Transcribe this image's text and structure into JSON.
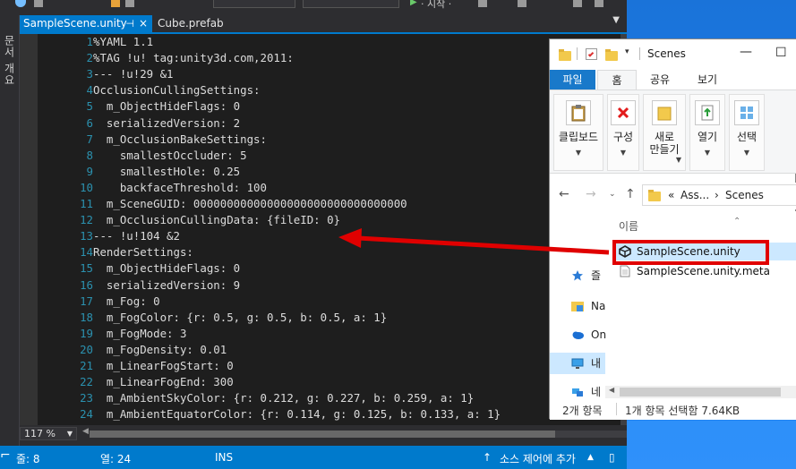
{
  "vs": {
    "toolbar": {
      "run_label_partial": "· 시작 ·"
    },
    "sidetool_label": "문서 개요",
    "tabs": [
      {
        "label": "SampleScene.unity",
        "pin": "⊣",
        "close": "×"
      },
      {
        "label": "Cube.prefab"
      }
    ],
    "code_lines": [
      {
        "n": "1",
        "text": "%YAML 1.1"
      },
      {
        "n": "2",
        "text": "%TAG !u! tag:unity3d.com,2011:"
      },
      {
        "n": "3",
        "text": "--- !u!29 &1"
      },
      {
        "n": "4",
        "text": "OcclusionCullingSettings:"
      },
      {
        "n": "5",
        "text": "  m_ObjectHideFlags: 0"
      },
      {
        "n": "6",
        "text": "  serializedVersion: 2"
      },
      {
        "n": "7",
        "text": "  m_OcclusionBakeSettings:"
      },
      {
        "n": "8",
        "text": "    smallestOccluder: 5"
      },
      {
        "n": "9",
        "text": "    smallestHole: 0.25"
      },
      {
        "n": "10",
        "text": "    backfaceThreshold: 100"
      },
      {
        "n": "11",
        "text": "  m_SceneGUID: 00000000000000000000000000000000"
      },
      {
        "n": "12",
        "text": "  m_OcclusionCullingData: {fileID: 0}"
      },
      {
        "n": "13",
        "text": "--- !u!104 &2"
      },
      {
        "n": "14",
        "text": "RenderSettings:"
      },
      {
        "n": "15",
        "text": "  m_ObjectHideFlags: 0"
      },
      {
        "n": "16",
        "text": "  serializedVersion: 9"
      },
      {
        "n": "17",
        "text": "  m_Fog: 0"
      },
      {
        "n": "18",
        "text": "  m_FogColor: {r: 0.5, g: 0.5, b: 0.5, a: 1}"
      },
      {
        "n": "19",
        "text": "  m_FogMode: 3"
      },
      {
        "n": "20",
        "text": "  m_FogDensity: 0.01"
      },
      {
        "n": "21",
        "text": "  m_LinearFogStart: 0"
      },
      {
        "n": "22",
        "text": "  m_LinearFogEnd: 300"
      },
      {
        "n": "23",
        "text": "  m_AmbientSkyColor: {r: 0.212, g: 0.227, b: 0.259, a: 1}"
      },
      {
        "n": "24",
        "text": "  m_AmbientEquatorColor: {r: 0.114, g: 0.125, b: 0.133, a: 1}"
      }
    ],
    "zoom": "117 %",
    "status": {
      "line": "줄: 8",
      "col": "열: 24",
      "mode": "INS",
      "source_control": "소스 제어에 추가"
    },
    "colors": {
      "accent": "#007acc",
      "line_number": "#2b91af",
      "code_text": "#dcdcdc"
    }
  },
  "explorer": {
    "title": "Scenes",
    "controls": {
      "minimize": "—",
      "maximize": "☐"
    },
    "ribbon_tabs": [
      "파일",
      "홈",
      "공유",
      "보기"
    ],
    "ribbon_groups": [
      {
        "label": "클립보드",
        "icon": "clipboard-icon"
      },
      {
        "label": "구성",
        "icon": "organize-delete-icon"
      },
      {
        "label": "새로\n만들기",
        "icon": "new-folder-icon"
      },
      {
        "label": "열기",
        "icon": "open-icon"
      },
      {
        "label": "선택",
        "icon": "select-icon"
      }
    ],
    "address": {
      "prefix": "«",
      "path1": "Ass...",
      "sep": "›",
      "path2": "Scenes"
    },
    "nav_items": [
      {
        "label": "즐",
        "icon": "star-icon"
      },
      {
        "label": "Na",
        "icon": "folder-image-icon"
      },
      {
        "label": "On",
        "icon": "onedrive-icon"
      },
      {
        "label": "내",
        "icon": "pc-icon"
      },
      {
        "label": "네",
        "icon": "network-icon"
      }
    ],
    "column_header": "이름",
    "files": [
      {
        "name": "SampleScene.unity",
        "icon": "unity-icon",
        "selected": true
      },
      {
        "name": "SampleScene.unity.meta",
        "icon": "file-icon",
        "selected": false
      }
    ],
    "status": {
      "count": "2개 항목",
      "selected": "1개 항목 선택함 7.64KB"
    }
  },
  "annotation": {
    "color": "#e00000"
  }
}
